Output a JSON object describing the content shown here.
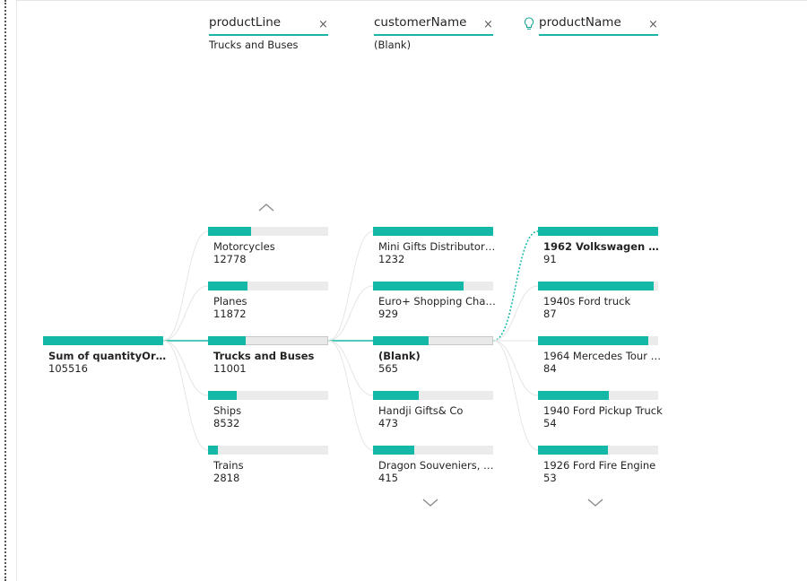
{
  "root": {
    "label": "Sum of quantityOrde...",
    "value": "105516",
    "fill": 1.0
  },
  "levels": [
    {
      "header": "productLine",
      "selected": "Trucks and Buses",
      "close": "×",
      "nodes": [
        {
          "label": "Motorcycles",
          "value": "12778",
          "fill": 0.36
        },
        {
          "label": "Planes",
          "value": "11872",
          "fill": 0.33
        },
        {
          "label": "Trucks and Buses",
          "value": "11001",
          "fill": 0.31,
          "selected": true
        },
        {
          "label": "Ships",
          "value": "8532",
          "fill": 0.24
        },
        {
          "label": "Trains",
          "value": "2818",
          "fill": 0.08
        }
      ]
    },
    {
      "header": "customerName",
      "selected": "(Blank)",
      "close": "×",
      "nodes": [
        {
          "label": "Mini Gifts Distributors ...",
          "value": "1232",
          "fill": 1.0
        },
        {
          "label": "Euro+ Shopping Chan...",
          "value": "929",
          "fill": 0.75
        },
        {
          "label": "(Blank)",
          "value": "565",
          "fill": 0.46,
          "selected": true
        },
        {
          "label": "Handji Gifts& Co",
          "value": "473",
          "fill": 0.38
        },
        {
          "label": "Dragon Souveniers, Ltd.",
          "value": "415",
          "fill": 0.34
        }
      ]
    },
    {
      "header": "productName",
      "selected": "",
      "close": "×",
      "nodes": [
        {
          "label": "1962 Volkswagen Mi...",
          "value": "91",
          "fill": 1.0,
          "bold": true
        },
        {
          "label": "1940s Ford truck",
          "value": "87",
          "fill": 0.96
        },
        {
          "label": "1964 Mercedes Tour Bus",
          "value": "84",
          "fill": 0.92
        },
        {
          "label": "1940 Ford Pickup Truck",
          "value": "54",
          "fill": 0.59
        },
        {
          "label": "1926 Ford Fire Engine",
          "value": "53",
          "fill": 0.58
        }
      ]
    }
  ],
  "colors": {
    "accent": "#14b8a6",
    "track": "#ebebeb"
  },
  "icons": {
    "close": "close-icon",
    "up": "chevron-up-icon",
    "down": "chevron-down-icon",
    "ai": "lightbulb-icon"
  }
}
